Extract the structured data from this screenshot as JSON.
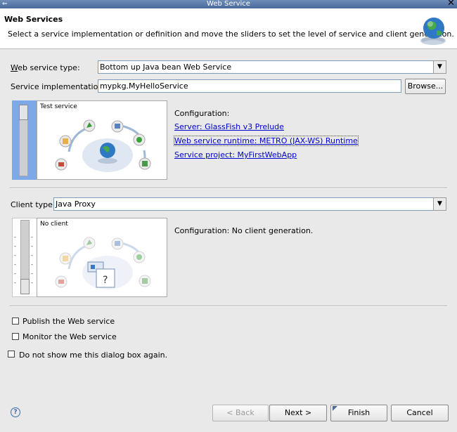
{
  "window": {
    "title": "Web Service",
    "close_glyph": "✕",
    "menu_glyph": "⇐"
  },
  "header": {
    "title": "Web Services",
    "description": "Select a service implementation or definition and move the sliders to set the level of service and client generation.",
    "icon": "globe-with-hand-icon"
  },
  "service": {
    "type_label": "Web service type:",
    "type_value": "Bottom up Java bean Web Service",
    "impl_label": "Service implementation:",
    "impl_value": "mypkg.MyHelloService",
    "browse_label": "Browse...",
    "slider_level": "Test service",
    "configuration_label": "Configuration:",
    "server_link": "Server: GlassFish v3 Prelude",
    "runtime_link": "Web service runtime: METRO (JAX-WS) Runtime",
    "project_link": "Service project: MyFirstWebApp"
  },
  "client": {
    "type_label": "Client type:",
    "type_value": "Java Proxy",
    "slider_level": "No client",
    "configuration_text": "Configuration: No client generation."
  },
  "options": {
    "publish_label": "Publish the Web service",
    "monitor_label": "Monitor the Web service",
    "dont_show_label": "Do not show me this dialog box again.",
    "publish_checked": false,
    "monitor_checked": false,
    "dont_show_checked": false
  },
  "footer": {
    "help_glyph": "?",
    "back_label": "< Back",
    "next_label": "Next >",
    "finish_label": "Finish",
    "cancel_label": "Cancel"
  },
  "colors": {
    "link": "#0000cc",
    "slider_active": "#7ea9e6",
    "title_bar": "#5a7aac"
  }
}
